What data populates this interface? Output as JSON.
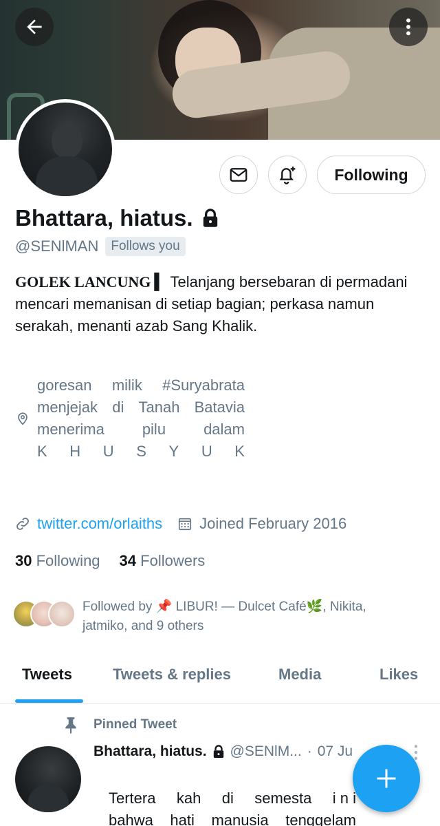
{
  "header": {
    "back_icon": "arrow-left-icon",
    "more_icon": "more-vertical-icon"
  },
  "profile": {
    "name": "Bhattara, hiatus.",
    "protected_icon": "lock-icon",
    "handle": "@SENlMAN",
    "follows_you": "Follows you",
    "actions": {
      "message_icon": "mail-icon",
      "notify_icon": "bell-plus-icon",
      "following_label": "Following"
    },
    "bio": {
      "title": "GOLEK LANCUNG ▍",
      "text": "Telanjang bersebaran di permadani mencari memanisan di setiap bagian; perkasa namun serakah, menanti azab Sang Khalik."
    },
    "location": {
      "icon": "location-pin-icon",
      "lines": [
        [
          "goresan",
          "milik",
          "#Suryabrata"
        ],
        [
          "menjejak",
          "di",
          "Tanah",
          "Batavia"
        ],
        [
          "menerima",
          "pilu",
          "dalam"
        ],
        [
          "K",
          "H",
          "U",
          "S",
          "Y",
          "U",
          "K"
        ]
      ]
    },
    "website": {
      "icon": "link-icon",
      "text": "twitter.com/orlaiths"
    },
    "joined": {
      "icon": "calendar-icon",
      "text": "Joined February 2016"
    },
    "counts": {
      "following_count": "30",
      "following_label": "Following",
      "followers_count": "34",
      "followers_label": "Followers"
    },
    "followed_by": "Followed by 📌 LIBUR! — Dulcet Café🌿, Nikita, jatmiko, and 9 others"
  },
  "tabs": [
    {
      "label": "Tweets",
      "active": true
    },
    {
      "label": "Tweets & replies",
      "active": false
    },
    {
      "label": "Media",
      "active": false
    },
    {
      "label": "Likes",
      "active": false
    }
  ],
  "pinned_tweet": {
    "pin_icon": "pin-icon",
    "label": "Pinned Tweet",
    "author": "Bhattara, hiatus.",
    "handle": "@SENlM...",
    "separator": "·",
    "date": "07 Ju",
    "body_lines": [
      [
        "Tertera",
        "kah",
        "di",
        "semesta",
        "i n i"
      ],
      [
        "bahwa",
        "hati",
        "manusia",
        "tenggelam"
      ]
    ]
  },
  "fab": {
    "icon": "plus-icon"
  },
  "colors": {
    "accent": "#1da1f2",
    "muted": "#657786",
    "text": "#14171a"
  }
}
